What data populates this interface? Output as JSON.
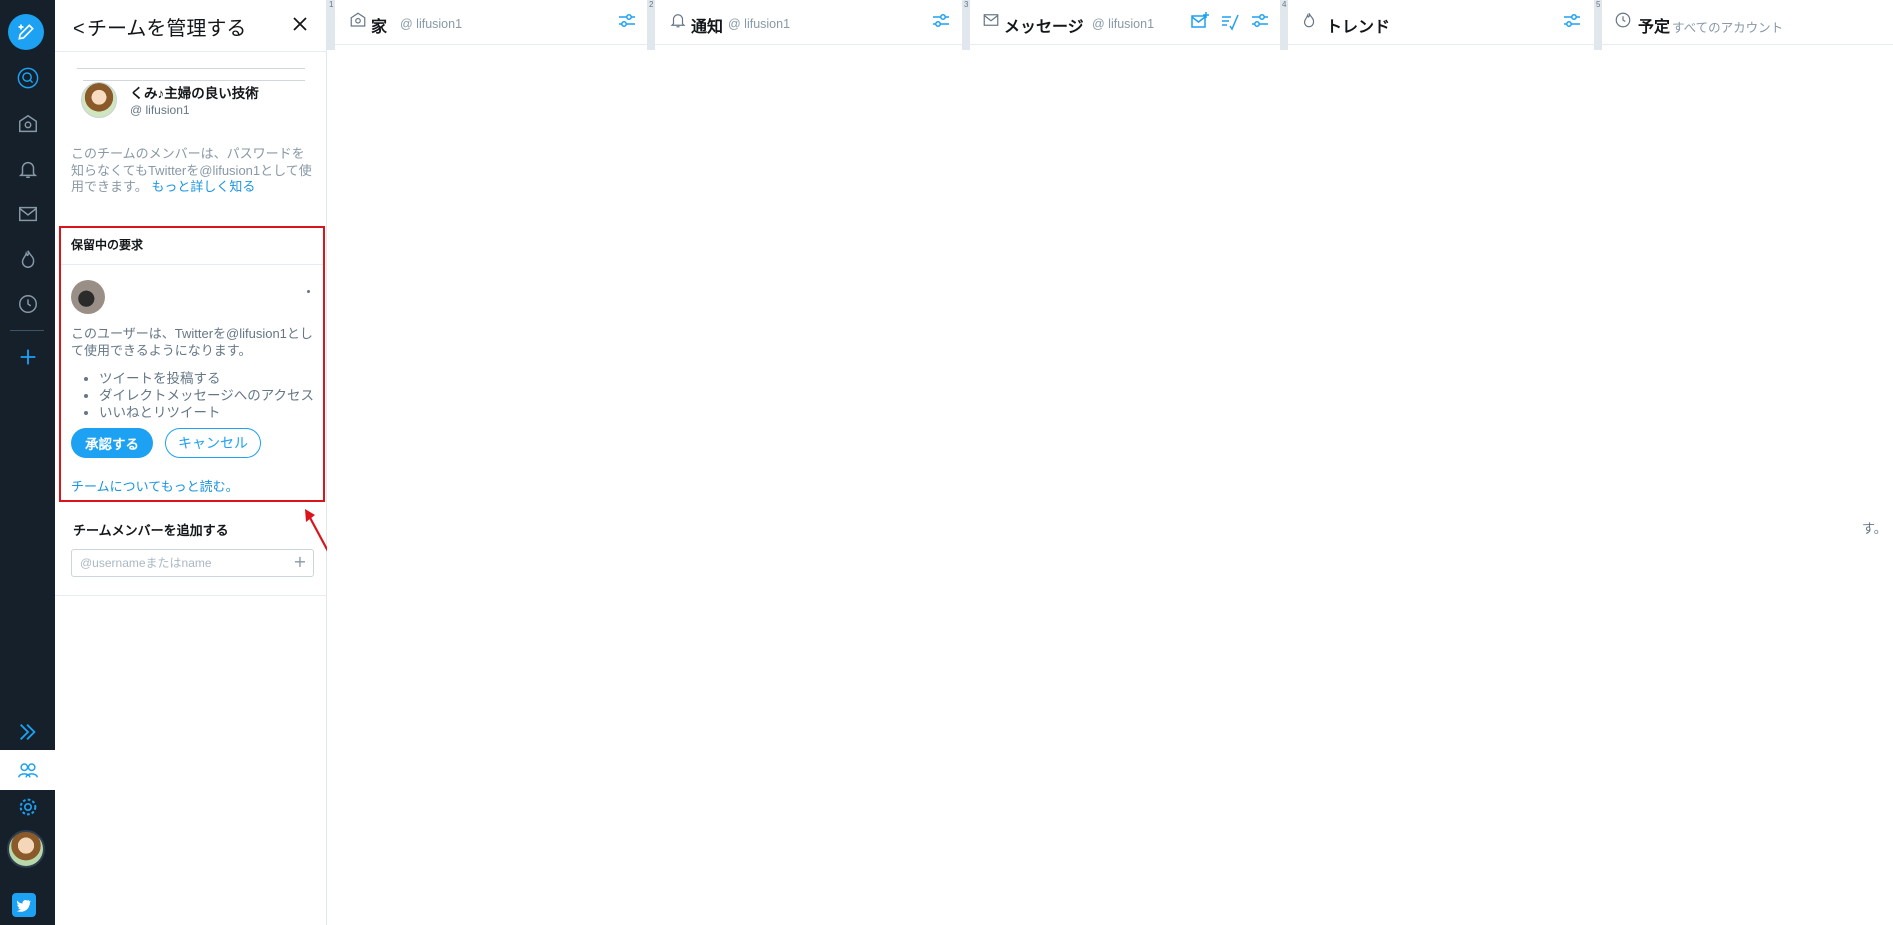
{
  "drawer": {
    "title": "チームを管理する",
    "account": {
      "name": "くみ♪主婦の良い技術",
      "handle": "@ lifusion1"
    },
    "description": "このチームのメンバーは、パスワードを知らなくてもTwitterを@lifusion1として使用できます。",
    "learn_more": "もっと詳しく知る",
    "pending": {
      "title": "保留中の要求",
      "description": "このユーザーは、Twitterを@lifusion1として使用できるようになります。",
      "permissions": [
        "ツイートを投稿する",
        "ダイレクトメッセージへのアクセス",
        "いいねとリツイート"
      ],
      "approve_label": "承認する",
      "cancel_label": "キャンセル",
      "read_more": "チームについてもっと読む。"
    },
    "add_member": {
      "title": "チームメンバーを追加する",
      "placeholder": "@usernameまたはname",
      "plus": "+"
    }
  },
  "columns": [
    {
      "number": "1",
      "icon": "home-icon",
      "title": "家",
      "subtitle": "@ lifusion1"
    },
    {
      "number": "2",
      "icon": "bell-icon",
      "title": "通知",
      "subtitle": "@ lifusion1"
    },
    {
      "number": "3",
      "icon": "mail-icon",
      "title": "メッセージ",
      "subtitle": "@ lifusion1"
    },
    {
      "number": "4",
      "icon": "flame-icon",
      "title": "トレンド",
      "subtitle": ""
    },
    {
      "number": "5",
      "icon": "clock-icon",
      "title": "予定",
      "subtitle": "すべてのアカウント"
    }
  ],
  "stray_text": "す。",
  "colors": {
    "nav_bg": "#15202b",
    "accent": "#1da1f2",
    "highlight_border": "#d9141b"
  }
}
